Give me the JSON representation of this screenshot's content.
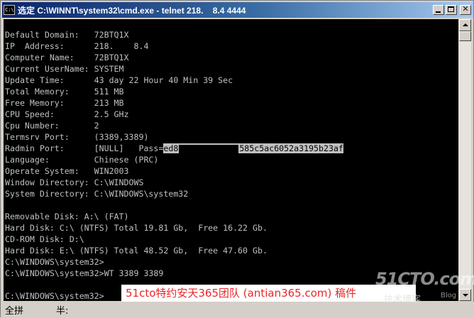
{
  "window": {
    "title": "选定 C:\\WINNT\\system32\\cmd.exe - telnet 218.    8.4 4444",
    "icon_label": "C:\\"
  },
  "console": {
    "lines": [
      "Default Domain:   72BTQ1X",
      "IP  Address:      218.    8.4",
      "Computer Name:    72BTQ1X",
      "Current UserName: SYSTEM",
      "Update Time:      43 day 22 Hour 40 Min 39 Sec",
      "Total Memory:     511 MB",
      "Free Memory:      213 MB",
      "CPU Speed:        2.5 GHz",
      "Cpu Number:       2",
      "Termsrv Port:     (3389,3389)",
      "Language:         Chinese (PRC)",
      "Operate System:   WIN2003",
      "Window Directory: C:\\WINDOWS",
      "System Directory: C:\\WINDOWS\\system32",
      "",
      "Removable Disk: A:\\ (FAT)",
      "Hard Disk: C:\\ (NTFS) Total 19.81 Gb,  Free 16.22 Gb.",
      "CD-ROM Disk: D:\\",
      "Hard Disk: E:\\ (NTFS) Total 48.52 Gb,  Free 47.60 Gb.",
      "C:\\WINDOWS\\system32>",
      "C:\\WINDOWS\\system32>WT 3389 3389",
      "",
      "C:\\WINDOWS\\system32>"
    ],
    "radmin": {
      "label": "Radmin Port:      [NULL]   Pass=",
      "pass_start": "ed8",
      "pass_end": "585c5ac6052a3195b23af"
    }
  },
  "statusbar": {
    "ime_mode": "全拼",
    "ime_width": "半:"
  },
  "watermark": {
    "banner": "51cto特约安天365团队 (antian365.com) 稿件",
    "logo": "51CTO.com",
    "logo_sub": "技术博客",
    "logo_blog": "Blog"
  },
  "colors": {
    "console_bg": "#000000",
    "console_text": "#c0c0c0",
    "titlebar_start": "#0a246a",
    "titlebar_end": "#a6caf0",
    "banner_text": "#e8262a"
  }
}
